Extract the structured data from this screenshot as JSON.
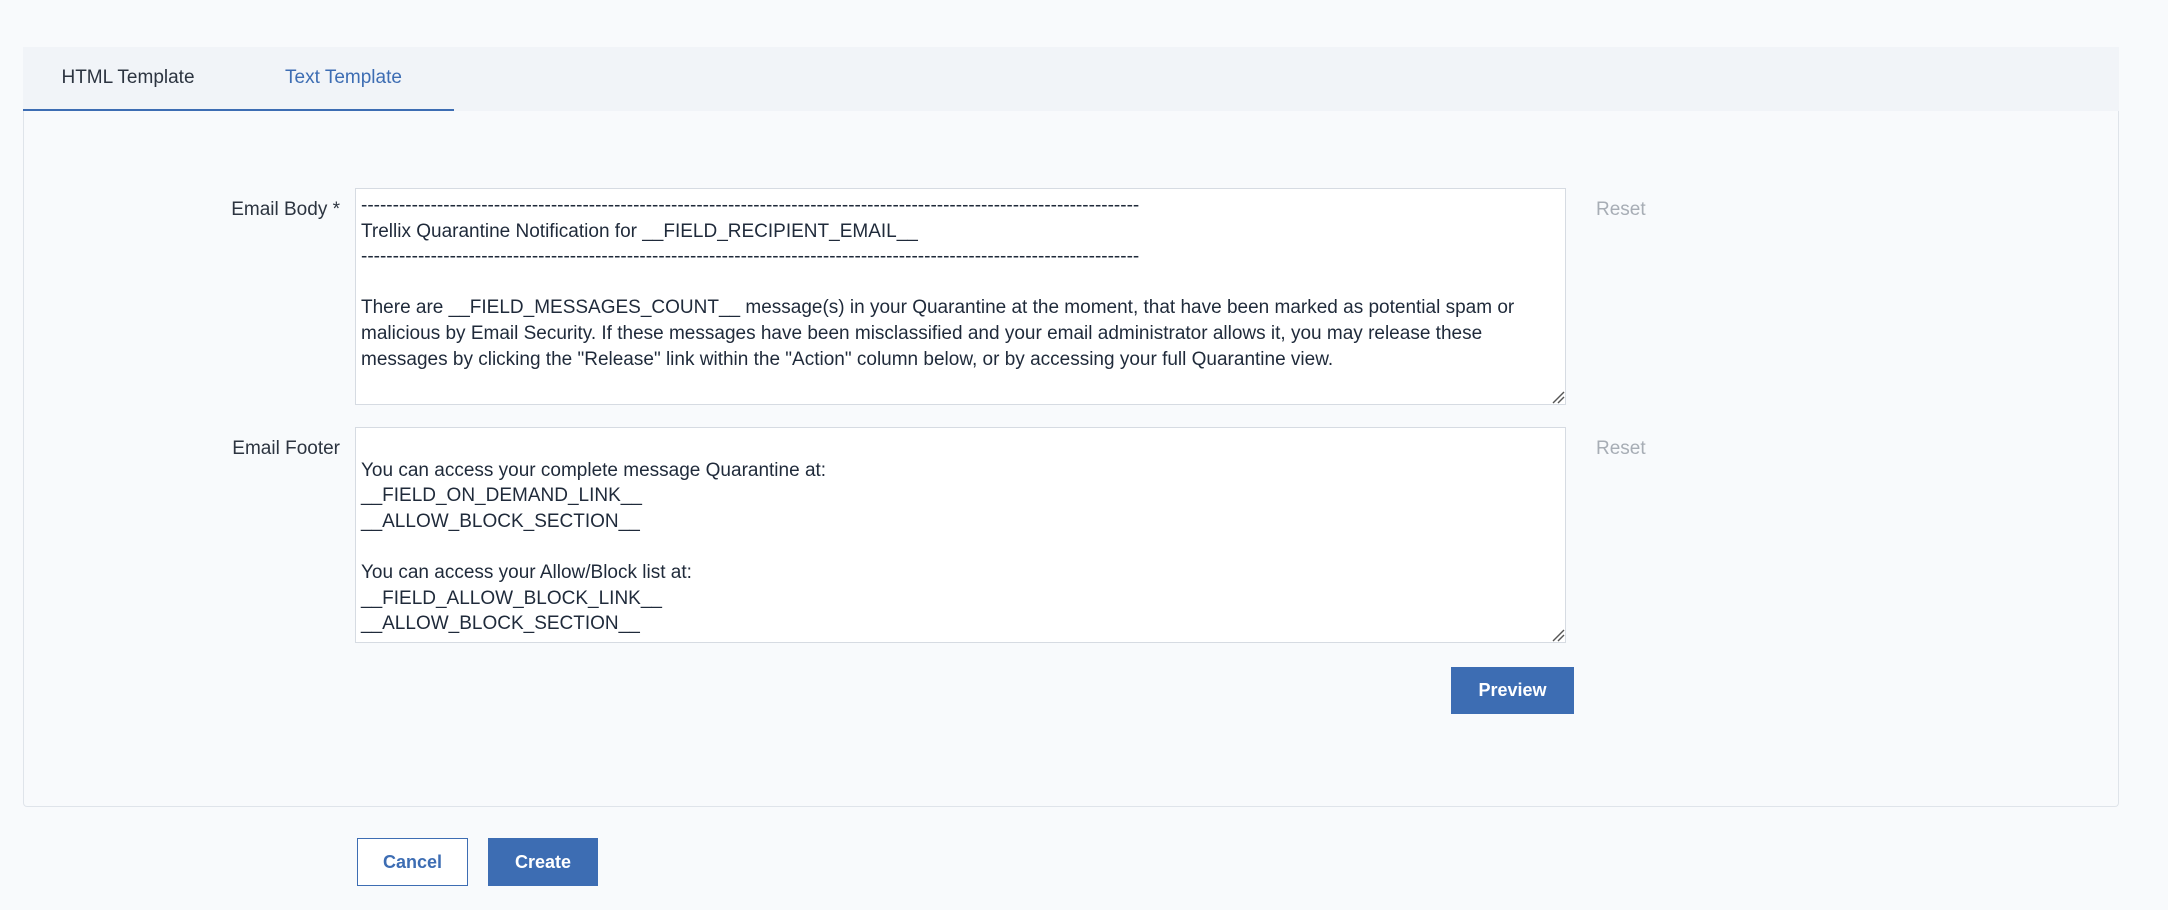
{
  "tabs": {
    "html_label": "HTML Template",
    "text_label": "Text Template"
  },
  "email_body": {
    "label": "Email Body *",
    "value": "---------------------------------------------------------------------------------------------------------------------------\nTrellix Quarantine Notification for __FIELD_RECIPIENT_EMAIL__\n---------------------------------------------------------------------------------------------------------------------------\n\nThere are __FIELD_MESSAGES_COUNT__ message(s) in your Quarantine at the moment, that have been marked as potential spam or malicious by Email Security. If these messages have been misclassified and your email administrator allows it, you may release these messages by clicking the \"Release\" link within the \"Action\" column below, or by accessing your full Quarantine view.",
    "reset_label": "Reset"
  },
  "email_footer": {
    "label": "Email Footer",
    "value": "\nYou can access your complete message Quarantine at:\n__FIELD_ON_DEMAND_LINK__\n__ALLOW_BLOCK_SECTION__\n\nYou can access your Allow/Block list at:\n__FIELD_ALLOW_BLOCK_LINK__\n__ALLOW_BLOCK_SECTION__",
    "reset_label": "Reset"
  },
  "buttons": {
    "preview": "Preview",
    "cancel": "Cancel",
    "create": "Create"
  },
  "colors": {
    "accent": "#3d6db3",
    "muted": "#a7adb5"
  }
}
